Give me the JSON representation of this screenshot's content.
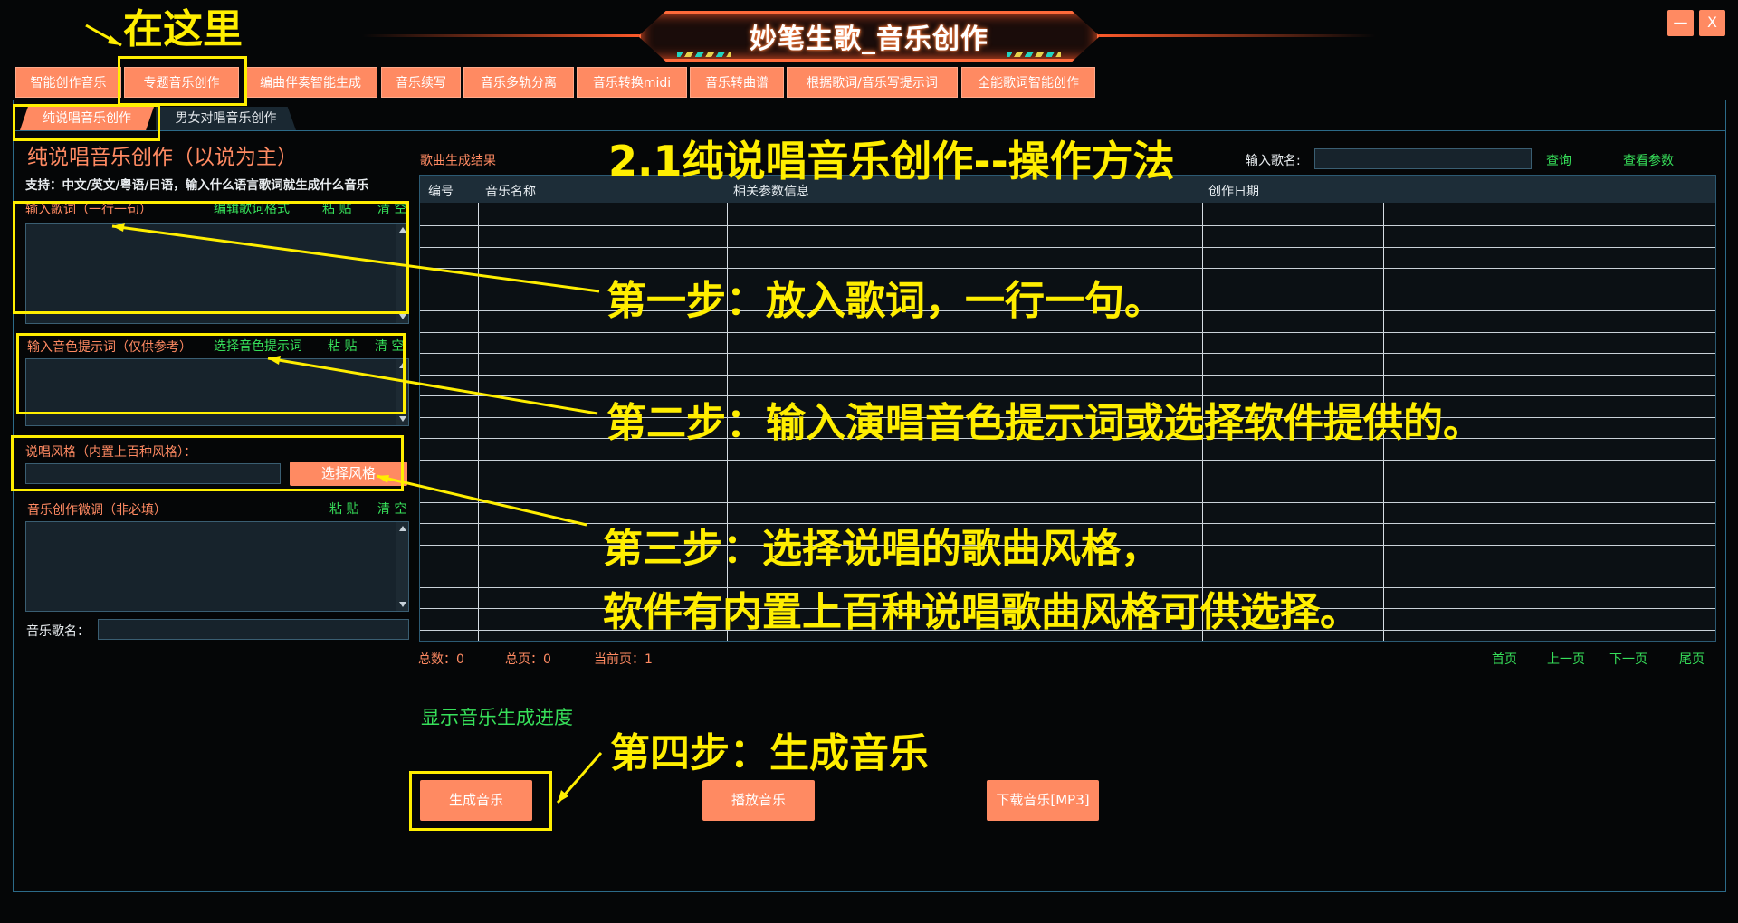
{
  "app": {
    "title": "妙笔生歌_音乐创作",
    "minimize": "—",
    "close": "X"
  },
  "annotation_top": "在这里",
  "tabs": [
    "智能创作音乐",
    "专题音乐创作",
    "编曲伴奏智能生成",
    "音乐续写",
    "音乐多轨分离",
    "音乐转换midi",
    "音乐转曲谱",
    "根据歌词/音乐写提示词",
    "全能歌词智能创作"
  ],
  "subtabs": [
    "纯说唱音乐创作",
    "男女对唱音乐创作"
  ],
  "left": {
    "title": "纯说唱音乐创作（以说为主）",
    "support": "支持：中文/英文/粤语/日语，输入什么语言歌词就生成什么音乐",
    "lyrics_label": "输入歌词（一行一句）",
    "lyrics_edit": "编辑歌词格式",
    "paste": "粘 贴",
    "clear": "清 空",
    "timbre_label": "输入音色提示词（仅供参考）",
    "timbre_select": "选择音色提示词",
    "style_label": "说唱风格（内置上百种风格）：",
    "style_button": "选择风格",
    "tune_label": "音乐创作微调（非必填）",
    "song_name_label": "音乐歌名："
  },
  "results": {
    "title": "歌曲生成结果",
    "search_label": "输入歌名:",
    "query": "查询",
    "view_params": "查看参数",
    "columns": [
      "编号",
      "音乐名称",
      "相关参数信息",
      "创作日期"
    ]
  },
  "pager": {
    "total": "总数：0",
    "pages": "总页：0",
    "current": "当前页：1",
    "first": "首页",
    "prev": "上一页",
    "next": "下一页",
    "last": "尾页"
  },
  "progress_text": "显示音乐生成进度",
  "buttons": {
    "generate": "生成音乐",
    "play": "播放音乐",
    "download": "下载音乐[MP3]"
  },
  "annotations": {
    "heading": "2.1纯说唱音乐创作--操作方法",
    "step1": "第一步：放入歌词，一行一句。",
    "step2": "第二步：输入演唱音色提示词或选择软件提供的。",
    "step3a": "第三步：选择说唱的歌曲风格，",
    "step3b": "软件有内置上百种说唱歌曲风格可供选择。",
    "step4": "第四步：生成音乐"
  },
  "colors": {
    "accent": "#ff8a62",
    "highlight": "#ffee00",
    "link_green": "#37e05a",
    "frame_blue": "#2c6a88"
  }
}
